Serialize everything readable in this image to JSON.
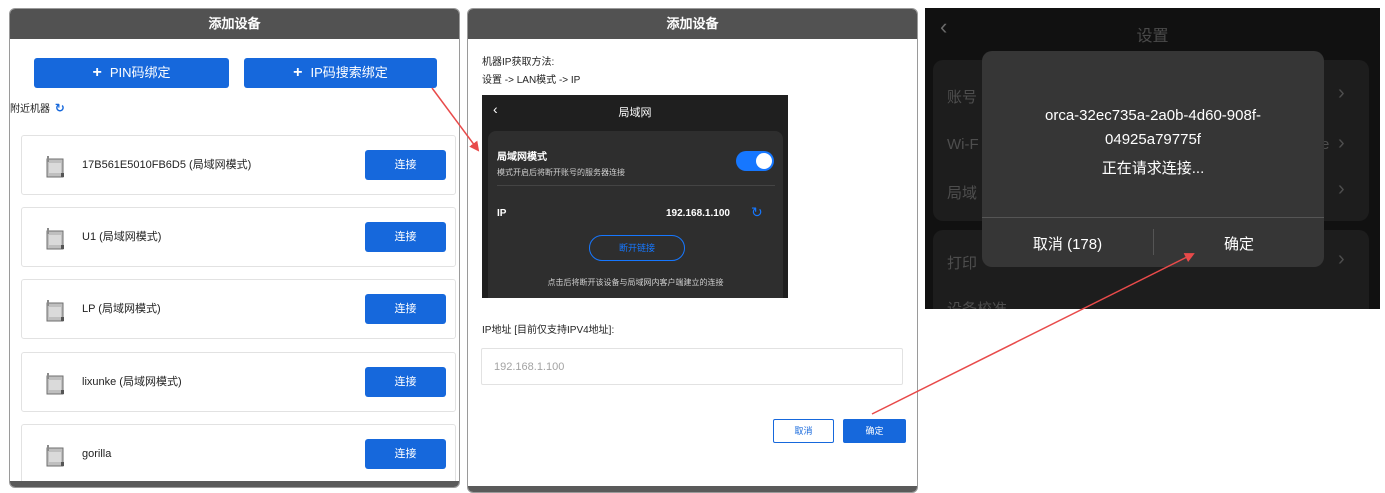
{
  "panel1": {
    "title": "添加设备",
    "pin_bind_label": "PIN码绑定",
    "ip_bind_label": "IP码搜索绑定",
    "nearby_label": "附近机器",
    "devices": [
      {
        "name": "17B561E5010FB6D5 (局域网模式)",
        "connect_label": "连接"
      },
      {
        "name": "U1 (局域网模式)",
        "connect_label": "连接"
      },
      {
        "name": "LP (局域网模式)",
        "connect_label": "连接"
      },
      {
        "name": "lixunke (局域网模式)",
        "connect_label": "连接"
      },
      {
        "name": "gorilla",
        "connect_label": "连接"
      }
    ]
  },
  "panel2": {
    "title": "添加设备",
    "method_line1": "机器IP获取方法:",
    "method_line2": "设置 -> LAN模式 -> IP",
    "lan_screen": {
      "title": "局域网",
      "mode_label": "局域网模式",
      "mode_desc": "模式开启后将断开账号的服务器连接",
      "ip_label": "IP",
      "ip_value": "192.168.1.100",
      "disconnect_label": "断开链接",
      "footer_note": "点击后将断开该设备与局域网内客户端建立的连接"
    },
    "ip_address_label": "IP地址 [目前仅支持IPV4地址]:",
    "ip_input_value": "192.168.1.100",
    "cancel_label": "取消",
    "confirm_label": "确定"
  },
  "panel3": {
    "title": "设置",
    "row_labels": [
      "账号",
      "Wi-F",
      "局域",
      "打印",
      "设备校准"
    ],
    "wifi_trailing": "e",
    "dialog_line1": "orca-32ec735a-2a0b-4d60-908f-",
    "dialog_line2": "04925a79775f",
    "dialog_status": "正在请求连接...",
    "cancel_label": "取消 (178)",
    "confirm_label": "确定"
  },
  "colors": {
    "primary_blue": "#1668dc",
    "title_bar": "#525252",
    "annotation_red": "#e84a4a",
    "toggle_blue": "#1677ff"
  }
}
